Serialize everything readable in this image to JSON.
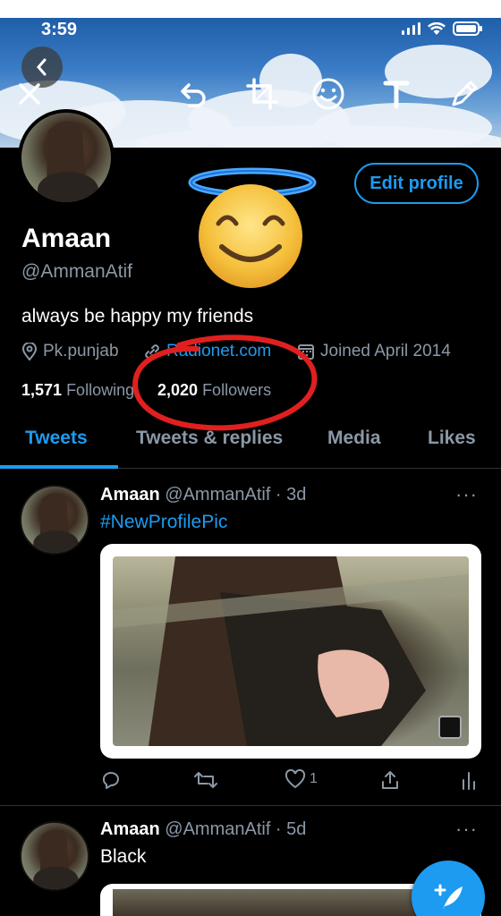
{
  "status_bar": {
    "time": "3:59"
  },
  "profile": {
    "name": "Amaan",
    "handle": "@AmmanAtif",
    "bio": "always be happy my friends",
    "location": "Pk.punjab",
    "website": "Radionet.com",
    "joined": "Joined April 2014",
    "following_count": "1,571",
    "following_label": "Following",
    "followers_count": "2,020",
    "followers_label": "Followers",
    "edit_profile_label": "Edit profile"
  },
  "tabs": [
    "Tweets",
    "Tweets & replies",
    "Media",
    "Likes"
  ],
  "tweets": [
    {
      "name": "Amaan",
      "meta": "@AmmanAtif · 3d",
      "text": "#NewProfilePic",
      "likes": "1"
    },
    {
      "name": "Amaan",
      "meta": "@AmmanAtif · 5d",
      "text": "Black"
    }
  ],
  "more_glyph": "···",
  "colors": {
    "accent": "#1d9bf0",
    "background": "#000000",
    "muted": "#8b98a5",
    "annotation": "#e0201f"
  },
  "icons": [
    "back-icon",
    "close-icon",
    "undo-icon",
    "crop-icon",
    "emoji-icon",
    "text-icon",
    "pen-icon",
    "location-icon",
    "link-icon",
    "calendar-icon",
    "reply-icon",
    "retweet-icon",
    "like-icon",
    "share-icon",
    "analytics-icon",
    "compose-icon"
  ]
}
